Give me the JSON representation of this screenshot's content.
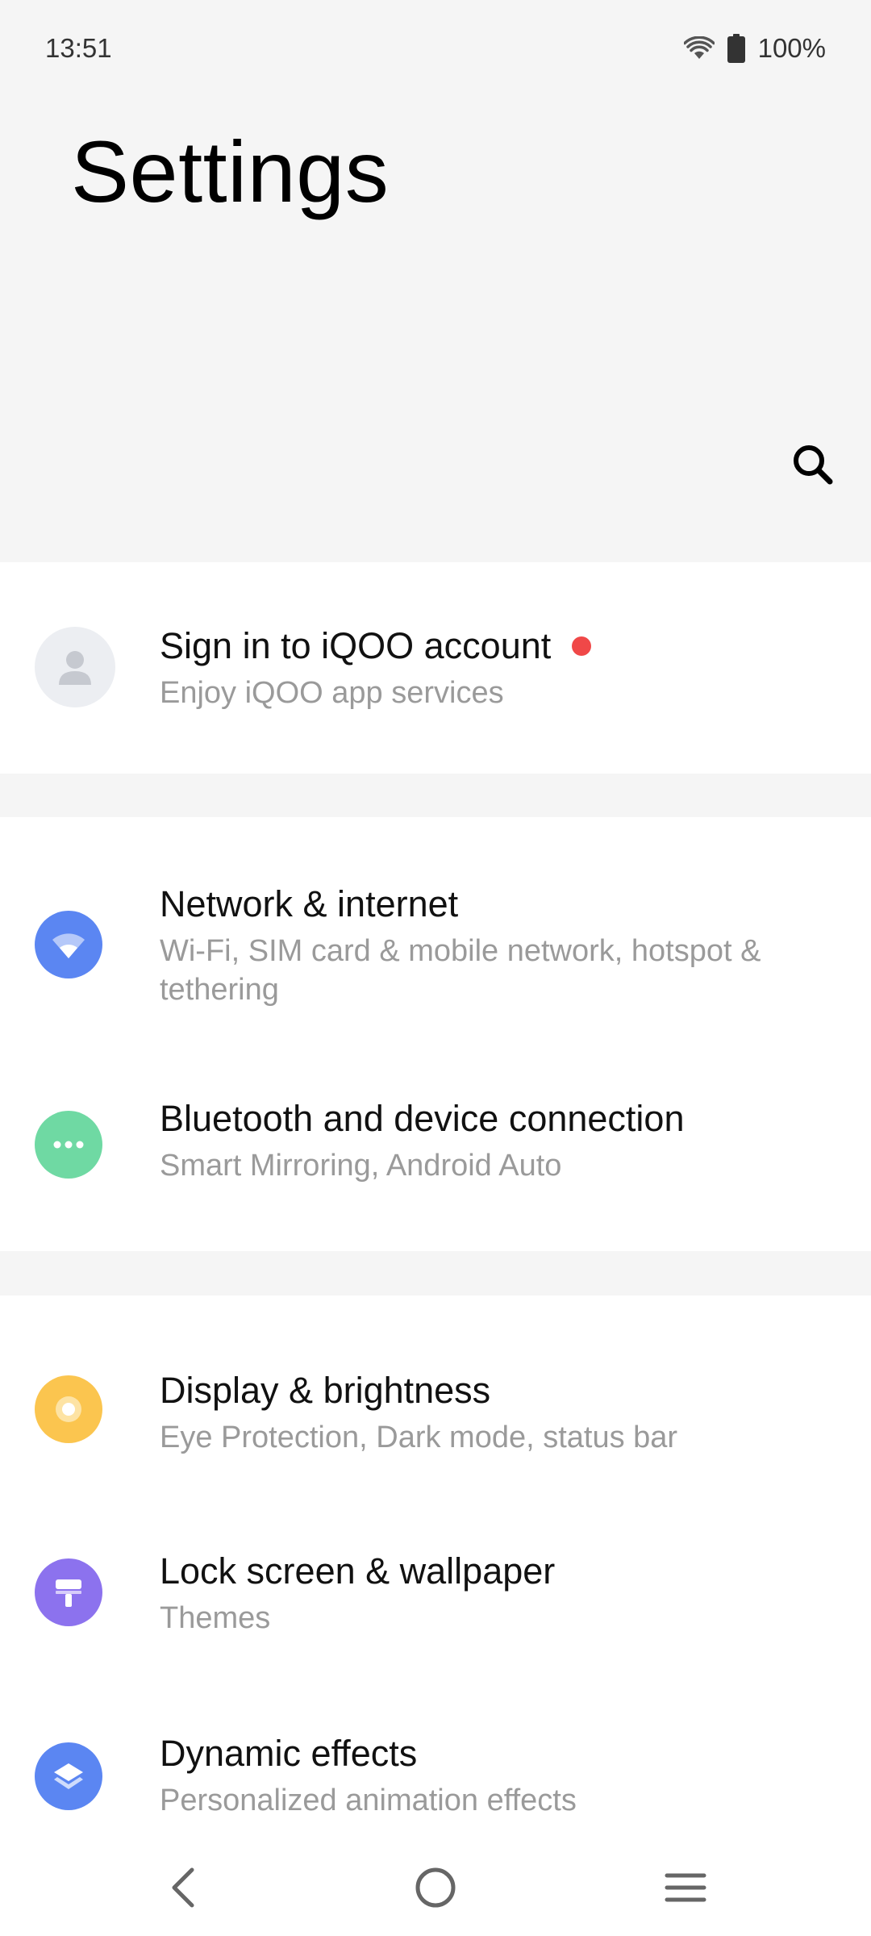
{
  "status_bar": {
    "time": "13:51",
    "battery": "100%",
    "icons": [
      "wifi-icon",
      "battery-icon"
    ]
  },
  "header": {
    "title": "Settings",
    "search_icon": "search-icon"
  },
  "account": {
    "title": "Sign in to iQOO account",
    "subtitle": "Enjoy iQOO app services",
    "icon": "avatar-icon",
    "has_notification_dot": true
  },
  "connectivity": [
    {
      "title": "Network & internet",
      "subtitle": "Wi-Fi, SIM card & mobile network, hotspot & tethering",
      "icon": "wifi-icon",
      "color": "#5b86f2"
    },
    {
      "title": "Bluetooth and device connection",
      "subtitle": "Smart Mirroring, Android Auto",
      "icon": "dots-icon",
      "color": "#6fd9a3"
    }
  ],
  "personalization": [
    {
      "title": "Display & brightness",
      "subtitle": "Eye Protection, Dark mode, status bar",
      "icon": "brightness-icon",
      "color": "#fbc54f"
    },
    {
      "title": "Lock screen & wallpaper",
      "subtitle": "Themes",
      "icon": "brush-icon",
      "color": "#8c72ee"
    },
    {
      "title": "Dynamic effects",
      "subtitle": "Personalized animation effects",
      "icon": "layers-icon",
      "color": "#5b86f2"
    }
  ],
  "nav": {
    "back_icon": "back-icon",
    "home_icon": "home-icon",
    "menu_icon": "menu-icon"
  }
}
